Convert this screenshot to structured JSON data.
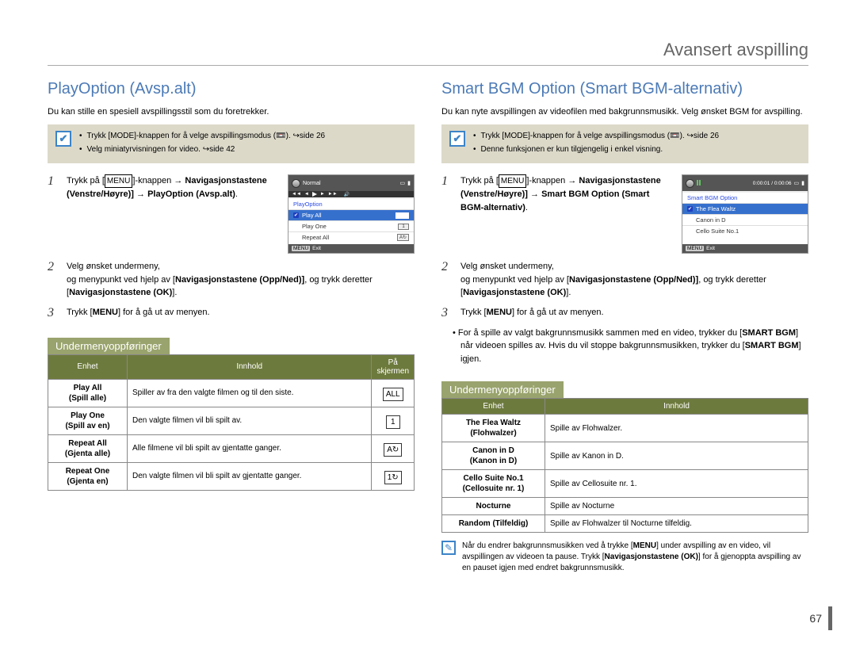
{
  "header": {
    "title": "Avansert avspilling"
  },
  "pageNumber": "67",
  "left": {
    "title": "PlayOption (Avsp.alt)",
    "intro": "Du kan stille en spesiell avspillingsstil som du foretrekker.",
    "note": {
      "items": [
        "Trykk [MODE]-knappen for å velge avspillingsmodus (📼). ↪side 26",
        "Velg miniatyrvisningen for video. ↪side 42"
      ]
    },
    "steps": {
      "s1": "MENU",
      "s1_text_a": "Trykk på [",
      "s1_text_b": "]-knappen →",
      "s1_bold": "Navigasjonstastene (Venstre/Høyre)] → PlayOption (Avsp.alt)",
      "s2_a": "Velg ønsket undermeny,",
      "s2_b": "og menypunkt ved hjelp av",
      "s2_bold1": "Navigasjonstastene (Opp/Ned)]",
      "s2_c": ", og trykk deretter [",
      "s2_bold2": "Navigasjonstastene (OK)",
      "s2_d": "].",
      "s3_a": "Trykk [",
      "s3_menu": "MENU",
      "s3_b": "] for å gå ut av menyen."
    },
    "screen": {
      "topNormal": "Normal",
      "panelTitle": "PlayOption",
      "items": [
        {
          "label": "Play All",
          "icon": "ALL",
          "selected": true
        },
        {
          "label": "Play One",
          "icon": "1",
          "selected": false
        },
        {
          "label": "Repeat All",
          "icon": "A↻",
          "selected": false
        }
      ],
      "exit": "Exit",
      "menuChip": "MENU"
    },
    "subhead": "Undermenyoppføringer",
    "table": {
      "headers": {
        "enhet": "Enhet",
        "innhold": "Innhold",
        "skjerm": "På skjermen"
      },
      "rows": [
        {
          "enhet_main": "Play All",
          "enhet_sub": "(Spill alle)",
          "innhold": "Spiller av fra den valgte filmen og til den siste.",
          "icon": "ALL"
        },
        {
          "enhet_main": "Play One",
          "enhet_sub": "(Spill av en)",
          "innhold": "Den valgte filmen vil bli spilt av.",
          "icon": "1"
        },
        {
          "enhet_main": "Repeat All",
          "enhet_sub": "(Gjenta alle)",
          "innhold": "Alle filmene vil bli spilt av gjentatte ganger.",
          "icon": "A↻"
        },
        {
          "enhet_main": "Repeat One",
          "enhet_sub": "(Gjenta en)",
          "innhold": "Den valgte filmen vil bli spilt av gjentatte ganger.",
          "icon": "1↻"
        }
      ]
    }
  },
  "right": {
    "title": "Smart BGM Option (Smart BGM-alternativ)",
    "intro": "Du kan nyte avspillingen av videofilen med bakgrunnsmusikk. Velg ønsket BGM for avspilling.",
    "note": {
      "items": [
        "Trykk [MODE]-knappen for å velge avspillingsmodus (📼). ↪side 26",
        "Denne funksjonen er kun tilgjengelig i enkel visning."
      ]
    },
    "steps": {
      "s1": "MENU",
      "s1_text_a": "Trykk på [",
      "s1_text_b": "]-knappen →",
      "s1_bold": "Navigasjonstastene (Venstre/Høyre)] → Smart BGM Option (Smart BGM-alternativ)",
      "s2_a": "Velg ønsket undermeny,",
      "s2_b": "og menypunkt ved hjelp av",
      "s2_bold1": "Navigasjonstastene (Opp/Ned)]",
      "s2_c": ", og trykk deretter [",
      "s2_bold2": "Navigasjonstastene (OK)",
      "s2_d": "].",
      "s3_a": "Trykk [",
      "s3_menu": "MENU",
      "s3_b": "] for å gå ut av menyen."
    },
    "bullet": {
      "a": "For å spille av valgt bakgrunnsmusikk sammen med en video, trykker du [",
      "b1": "SMART BGM",
      "c": "] når videoen spilles av. Hvis du vil stoppe bakgrunnsmusikken, trykker du [",
      "b2": "SMART BGM",
      "d": "] igjen."
    },
    "screen": {
      "time": "0:00:01 / 0:00:06",
      "panelTitle": "Smart BGM Option",
      "items": [
        {
          "label": "The Flea Waltz",
          "selected": true
        },
        {
          "label": "Canon in D",
          "selected": false
        },
        {
          "label": "Cello Suite No.1",
          "selected": false
        }
      ],
      "exit": "Exit",
      "menuChip": "MENU"
    },
    "subhead": "Undermenyoppføringer",
    "table": {
      "headers": {
        "enhet": "Enhet",
        "innhold": "Innhold"
      },
      "rows": [
        {
          "enhet_main": "The Flea Waltz",
          "enhet_sub": "(Flohwalzer)",
          "innhold": "Spille av Flohwalzer."
        },
        {
          "enhet_main": "Canon in D",
          "enhet_sub": "(Kanon in D)",
          "innhold": "Spille av Kanon in D."
        },
        {
          "enhet_main": "Cello Suite No.1",
          "enhet_sub": "(Cellosuite nr. 1)",
          "innhold": "Spille av Cellosuite nr. 1."
        },
        {
          "enhet_main": "Nocturne",
          "enhet_sub": "",
          "innhold": "Spille av Nocturne"
        },
        {
          "enhet_main": "Random (Tilfeldig)",
          "enhet_sub": "",
          "innhold": "Spille av Flohwalzer til Nocturne tilfeldig."
        }
      ]
    },
    "footnote": {
      "a": "Når du endrer bakgrunnsmusikken ved å trykke [",
      "b1": "MENU",
      "c": "] under avspilling av en video, vil avspillingen av videoen ta pause. Trykk [",
      "b2": "Navigasjonstastene (OK)",
      "d": "] for å gjenoppta avspilling av en pauset igjen med endret bakgrunnsmusikk."
    }
  }
}
